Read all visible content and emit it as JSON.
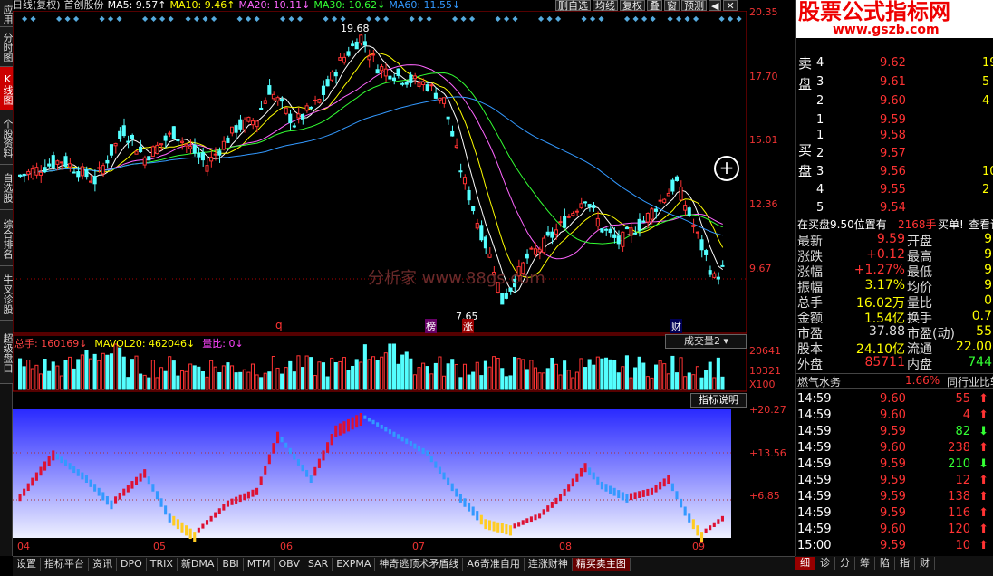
{
  "sidebar": {
    "tabs": [
      "应用",
      "分时图",
      "K线图",
      "个股资料",
      "自选股",
      "综合排名",
      "牛叉诊股",
      "超级盘口"
    ]
  },
  "topbar": {
    "items": [
      {
        "text": "日线(复权)",
        "color": "#dddddd"
      },
      {
        "text": "首创股份",
        "color": "#dddddd"
      },
      {
        "text": "MA5: 9.57↑",
        "color": "#ffffff"
      },
      {
        "text": "MA10: 9.46↑",
        "color": "#ffff00"
      },
      {
        "text": "MA20: 10.11↓",
        "color": "#ff66ff"
      },
      {
        "text": "MA30: 10.62↓",
        "color": "#33ff33"
      },
      {
        "text": "MA60: 11.55↓",
        "color": "#3399ff"
      }
    ]
  },
  "toolbar": [
    "删自选",
    "均线",
    "复权",
    "叠",
    "窗",
    "预测",
    "◀",
    "✕"
  ],
  "main_axis": [
    "20.35",
    "17.70",
    "15.01",
    "12.36",
    "9.67"
  ],
  "price_labels": {
    "high": "19.68",
    "low": "7.65"
  },
  "markers": {
    "q": "q",
    "bang": "榜",
    "zhang": "涨",
    "cai": "财"
  },
  "watermark": "分析家 www.88gs.com",
  "volume": {
    "header": [
      {
        "text": "总手: 160169↓",
        "color": "#ff4444"
      },
      {
        "text": "MAVOL20: 462046↓",
        "color": "#ffff00"
      },
      {
        "text": "量比: 0↓",
        "color": "#ff44ff"
      }
    ],
    "selector": "成交量2",
    "axis": [
      "20641",
      "10321",
      "X100"
    ]
  },
  "indicator": {
    "button": "指标说明",
    "axis": [
      "+20.27",
      "+13.56",
      "+6.85"
    ]
  },
  "xaxis": [
    "04",
    "05",
    "06",
    "07",
    "08",
    "09"
  ],
  "bottom_tabs": [
    "设置",
    "指标平台",
    "资讯",
    "DPO",
    "TRIX",
    "新DMA",
    "BBI",
    "MTM",
    "OBV",
    "SAR",
    "EXPMA",
    "神奇逃顶术矛盾线",
    "A6奇准自用",
    "连涨财神",
    "精买卖主图"
  ],
  "right": {
    "banner_title": "股票公式指标网",
    "banner_url": "www.gszb.com",
    "sell_label": "卖盘",
    "buy_label": "买盘",
    "sell": [
      [
        "4",
        "9.62",
        "19"
      ],
      [
        "3",
        "9.61",
        "5"
      ],
      [
        "2",
        "9.60",
        "4"
      ],
      [
        "1",
        "9.59",
        ""
      ]
    ],
    "buy": [
      [
        "1",
        "9.58",
        ""
      ],
      [
        "2",
        "9.57",
        ""
      ],
      [
        "3",
        "9.56",
        "10"
      ],
      [
        "4",
        "9.55",
        "2"
      ],
      [
        "5",
        "9.54",
        ""
      ]
    ],
    "queue_text": "在买盘9.50位置有",
    "queue_vol": "2168手",
    "queue_btn": "买单!",
    "queue_look": "查看详",
    "stats": [
      [
        "最新",
        "9.59",
        "开盘",
        "9"
      ],
      [
        "涨跌",
        "+0.12",
        "最高",
        "9"
      ],
      [
        "涨幅",
        "+1.27%",
        "最低",
        "9"
      ],
      [
        "振幅",
        "3.17%",
        "均价",
        "9"
      ],
      [
        "总手",
        "16.02万",
        "量比",
        "0"
      ],
      [
        "金额",
        "1.54亿",
        "换手",
        "0.7"
      ],
      [
        "市盈",
        "37.88",
        "市盈(动)",
        "55"
      ],
      [
        "股本",
        "24.10亿",
        "流通",
        "22.00"
      ],
      [
        "外盘",
        "85711",
        "内盘",
        "744"
      ]
    ],
    "sector": "燃气水务",
    "sector_pct": "1.66%",
    "sector_btn": "同行业比较",
    "ticks": [
      [
        "14:59",
        "9.60",
        "55",
        "up"
      ],
      [
        "14:59",
        "9.60",
        "4",
        "up"
      ],
      [
        "14:59",
        "9.59",
        "82",
        "down"
      ],
      [
        "14:59",
        "9.60",
        "238",
        "up"
      ],
      [
        "14:59",
        "9.59",
        "210",
        "down"
      ],
      [
        "14:59",
        "9.59",
        "12",
        "up"
      ],
      [
        "14:59",
        "9.59",
        "138",
        "up"
      ],
      [
        "14:59",
        "9.59",
        "116",
        "up"
      ],
      [
        "14:59",
        "9.60",
        "120",
        "up"
      ],
      [
        "15:00",
        "9.59",
        "10",
        "up"
      ]
    ],
    "bottom_tabs": [
      "细",
      "诊",
      "分",
      "筹",
      "陷",
      "指",
      "财"
    ]
  },
  "chart_data": {
    "type": "candlestick",
    "price_range": [
      7.0,
      20.5
    ],
    "high": 19.68,
    "low": 7.65,
    "ma_labels": [
      "MA5",
      "MA10",
      "MA20",
      "MA30",
      "MA60"
    ],
    "last_close": 9.59
  }
}
